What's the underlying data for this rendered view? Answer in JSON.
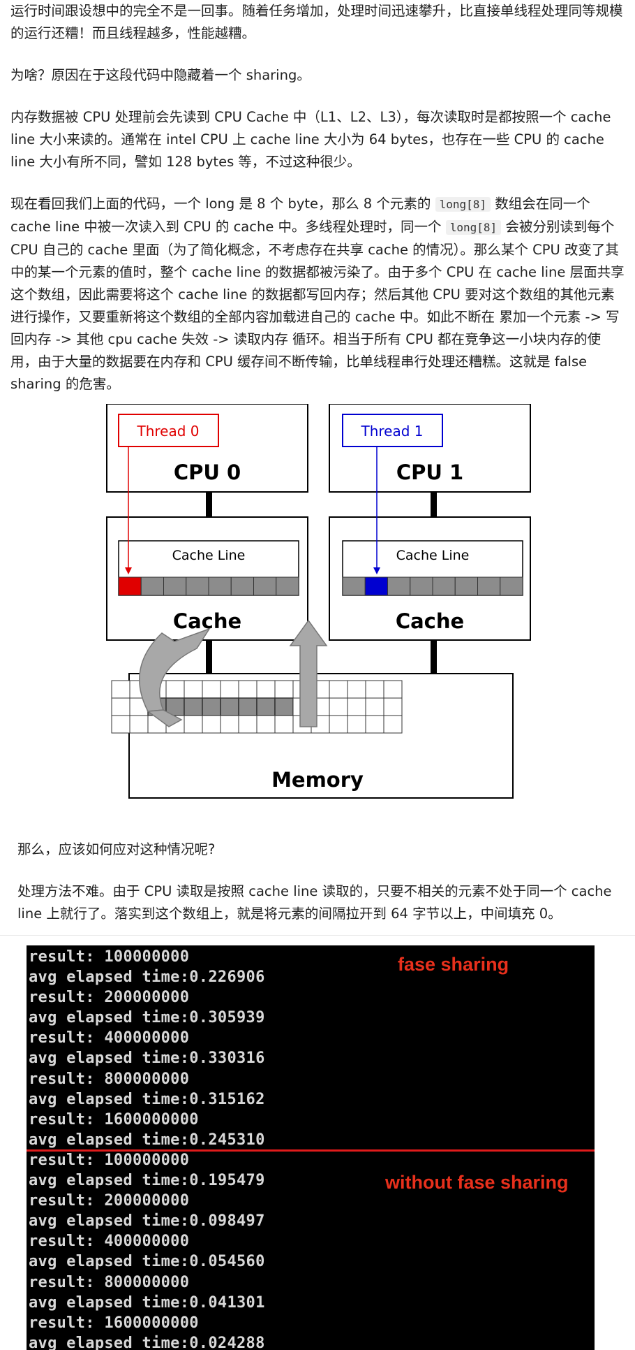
{
  "article": {
    "p1": "运行时间跟设想中的完全不是一回事。随着任务增加，处理时间迅速攀升，比直接单线程处理同等规模的运行还糟！而且线程越多，性能越糟。",
    "p2": "为啥？原因在于这段代码中隐藏着一个 sharing。",
    "p3": "内存数据被 CPU 处理前会先读到 CPU Cache 中（L1、L2、L3），每次读取时是都按照一个 cache line 大小来读的。通常在 intel CPU 上 cache line 大小为 64 bytes，也存在一些 CPU 的 cache line 大小有所不同，譬如 128 bytes 等，不过这种很少。",
    "p4_a": "现在看回我们上面的代码，一个 long 是 8 个 byte，那么 8 个元素的 ",
    "p4_code1": "long[8]",
    "p4_b": " 数组会在同一个 cache line 中被一次读入到 CPU 的 cache 中。多线程处理时，同一个 ",
    "p4_code2": "long[8]",
    "p4_c": " 会被分别读到每个 CPU 自己的 cache 里面（为了简化概念，不考虑存在共享 cache 的情况）。那么某个 CPU 改变了其中的某一个元素的值时，整个 cache line 的数据都被污染了。由于多个 CPU 在 cache line 层面共享这个数组，因此需要将这个 cache line 的数据都写回内存；然后其他 CPU 要对这个数组的其他元素进行操作，又要重新将这个数组的全部内容加载进自己的 cache 中。如此不断在 累加一个元素 -> 写回内存 -> 其他 cpu cache 失效 -> 读取内存 循环。相当于所有 CPU 都在竞争这一小块内存的使用，由于大量的数据要在内存和 CPU 缓存间不断传输，比单线程串行处理还糟糕。这就是 false sharing 的危害。",
    "p5": "那么，应该如何应对这种情况呢?",
    "p6": "处理方法不难。由于 CPU 读取是按照 cache line 读取的，只要不相关的元素不处于同一个 cache line 上就行了。落实到这个数组上，就是将元素的间隔拉开到 64 字节以上，中间填充 0。"
  },
  "diagram": {
    "thread0": "Thread 0",
    "thread1": "Thread 1",
    "cpu0": "CPU 0",
    "cpu1": "CPU 1",
    "cache_line": "Cache Line",
    "cache": "Cache",
    "memory": "Memory",
    "colors": {
      "thread0": "#e00000",
      "thread1": "#0000d0",
      "cell": "#8c8c8c",
      "arrow": "#a8a8a8"
    }
  },
  "terminal": {
    "label_top": "fase sharing",
    "label_bottom": "without fase sharing",
    "lines": [
      "result: 100000000",
      "avg elapsed time:0.226906",
      "result: 200000000",
      "avg elapsed time:0.305939",
      "result: 400000000",
      "avg elapsed time:0.330316",
      "result: 800000000",
      "avg elapsed time:0.315162",
      "result: 1600000000",
      "avg elapsed time:0.245310",
      "result: 100000000",
      "avg elapsed time:0.195479",
      "result: 200000000",
      "avg elapsed time:0.098497",
      "result: 400000000",
      "avg elapsed time:0.054560",
      "result: 800000000",
      "avg elapsed time:0.041301",
      "result: 1600000000",
      "avg elapsed time:0.024288"
    ]
  }
}
